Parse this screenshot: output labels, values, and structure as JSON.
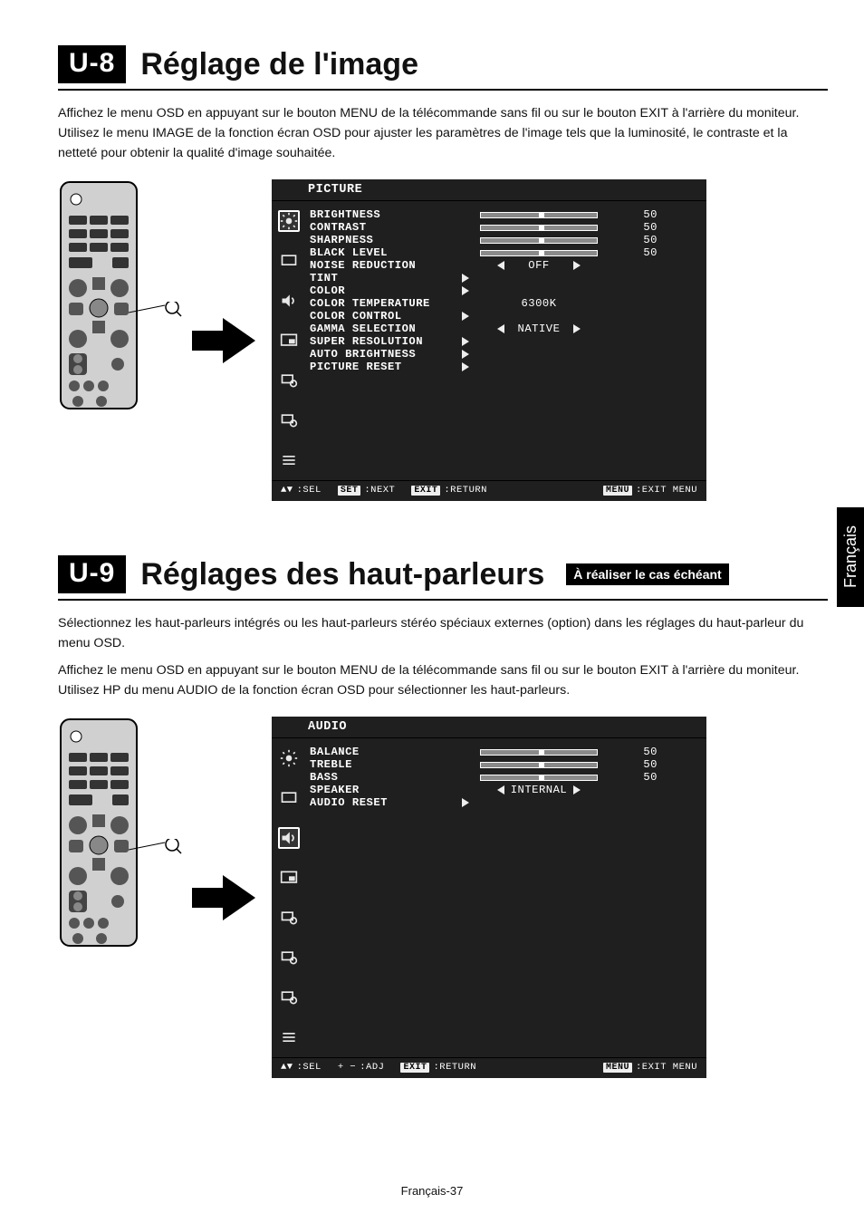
{
  "lang_tab": "Français",
  "page_number": "Français-37",
  "sec1": {
    "badge": "U-8",
    "title": "Réglage de l'image",
    "body": "Affichez le menu OSD en appuyant sur le bouton MENU de la télécommande sans fil ou sur le bouton EXIT à l'arrière du moniteur. Utilisez le menu IMAGE de la fonction écran OSD pour ajuster les paramètres de l'image tels que la luminosité, le contraste et la netteté pour obtenir la qualité d'image souhaitée."
  },
  "sec2": {
    "badge": "U-9",
    "title": "Réglages des haut-parleurs",
    "note": "À réaliser le cas échéant",
    "body1": "Sélectionnez les haut-parleurs intégrés ou les haut-parleurs stéréo spéciaux externes (option) dans les réglages du haut-parleur du menu OSD.",
    "body2": "Affichez le menu OSD en appuyant sur le bouton MENU de la télécommande sans fil ou sur le bouton EXIT à l'arrière du moniteur. Utilisez HP du menu AUDIO de la fonction écran OSD pour sélectionner les haut-parleurs."
  },
  "osd1": {
    "title": "PICTURE",
    "rows": [
      {
        "label": "BRIGHTNESS",
        "type": "slider",
        "value": "50"
      },
      {
        "label": "CONTRAST",
        "type": "slider",
        "value": "50"
      },
      {
        "label": "SHARPNESS",
        "type": "slider",
        "value": "50"
      },
      {
        "label": "BLACK LEVEL",
        "type": "slider",
        "value": "50"
      },
      {
        "label": "NOISE REDUCTION",
        "type": "select",
        "value": "OFF"
      },
      {
        "label": "TINT",
        "type": "arrow"
      },
      {
        "label": "COLOR",
        "type": "arrow"
      },
      {
        "label": "COLOR TEMPERATURE",
        "type": "text",
        "value": "6300K"
      },
      {
        "label": "COLOR CONTROL",
        "type": "arrow"
      },
      {
        "label": "GAMMA SELECTION",
        "type": "select",
        "value": "NATIVE"
      },
      {
        "label": "SUPER RESOLUTION",
        "type": "arrow"
      },
      {
        "label": "AUTO BRIGHTNESS",
        "type": "arrow"
      },
      {
        "label": "PICTURE RESET",
        "type": "arrow"
      }
    ],
    "footer": {
      "sel_glyph": "▲▼",
      "sel": ":SEL",
      "set_key": "SET",
      "set": ":NEXT",
      "exit_key": "EXIT",
      "exit": ":RETURN",
      "menu_key": "MENU",
      "menu": ":EXIT MENU"
    }
  },
  "osd2": {
    "title": "AUDIO",
    "rows": [
      {
        "label": "BALANCE",
        "type": "slider",
        "value": "50"
      },
      {
        "label": "TREBLE",
        "type": "slider",
        "value": "50"
      },
      {
        "label": "BASS",
        "type": "slider",
        "value": "50"
      },
      {
        "label": "SPEAKER",
        "type": "select",
        "value": "INTERNAL"
      },
      {
        "label": "AUDIO RESET",
        "type": "arrow"
      }
    ],
    "footer": {
      "sel_glyph": "▲▼",
      "sel": ":SEL",
      "adj_glyph": "+ −",
      "adj": ":ADJ",
      "exit_key": "EXIT",
      "exit": ":RETURN",
      "menu_key": "MENU",
      "menu": ":EXIT MENU"
    }
  }
}
